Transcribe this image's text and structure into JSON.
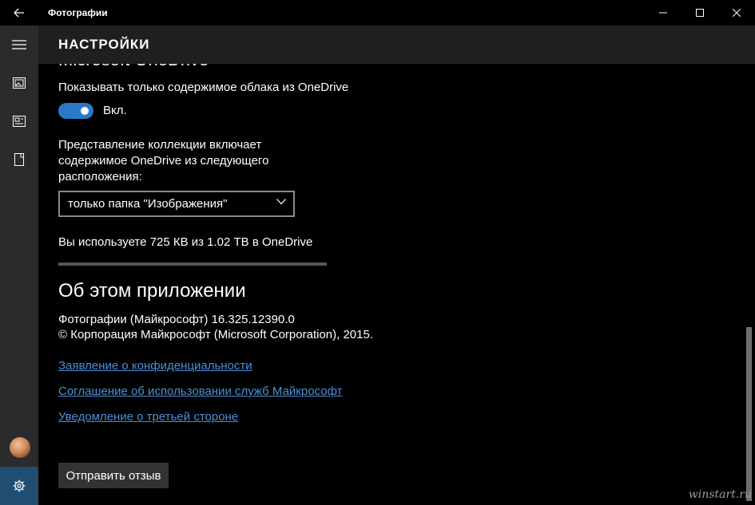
{
  "window": {
    "title": "Фотографии"
  },
  "header": {
    "title": "НАСТРОЙКИ"
  },
  "onedrive": {
    "heading": "Microsoft OneDrive",
    "cloud_label": "Показывать только содержимое облака из OneDrive",
    "toggle_on": true,
    "toggle_text": "Вкл.",
    "collection_line1": "Представление коллекции включает",
    "collection_line2": "содержимое OneDrive из следующего",
    "collection_line3": "расположения:",
    "location_value": "только папка \"Изображения\"",
    "usage_text": "Вы используете 725 КВ из 1.02 ТВ в OneDrive",
    "usage_fraction": 0.0
  },
  "about": {
    "title": "Об этом приложении",
    "version": "Фотографии (Майкрософт) 16.325.12390.0",
    "copyright": "© Корпорация Майкрософт (Microsoft Corporation), 2015.",
    "links": [
      "Заявление о конфиденциальности",
      "Соглашение об использовании служб Майкрософт",
      "Уведомление о третьей стороне"
    ],
    "feedback_button": "Отправить отзыв"
  },
  "watermark": "winstart.ru",
  "colors": {
    "accent": "#2a79c9",
    "link": "#4a8fd6",
    "nav_bg": "#2b2b2b",
    "header_bg": "#1f1f1f",
    "active_nav": "#1f4e72"
  },
  "icons": [
    "back-arrow-icon",
    "minimize-icon",
    "maximize-icon",
    "close-icon",
    "hamburger-icon",
    "collection-icon",
    "albums-icon",
    "folders-icon",
    "settings-gear-icon",
    "chevron-down-icon"
  ]
}
